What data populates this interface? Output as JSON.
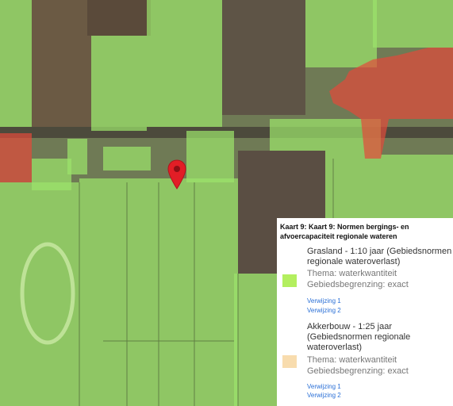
{
  "map": {
    "overlay_colors": {
      "grasland": "#9be36b",
      "bebouwing": "#e34a3b",
      "akkerbouw": "#f4d7a8"
    },
    "marker_icon": "map-pin-icon",
    "marker_color": "#e21e26"
  },
  "legend": {
    "title": "Kaart 9: Kaart 9: Normen bergings- en afvoercapaciteit regionale wateren",
    "entries": [
      {
        "name": "Grasland - 1:10 jaar (Gebiedsnormen regionale wateroverlast)",
        "theme": "Thema: waterkwantiteit",
        "boundary": "Gebiedsbegrenzing: exact",
        "swatch_color": "#b3ef5f",
        "links": [
          "Verwijzing 1",
          "Verwijzing 2"
        ]
      },
      {
        "name": "Akkerbouw - 1:25 jaar (Gebiedsnormen regionale wateroverlast)",
        "theme": "Thema: waterkwantiteit",
        "boundary": "Gebiedsbegrenzing: exact",
        "swatch_color": "#f8dcae",
        "links": [
          "Verwijzing 1",
          "Verwijzing 2"
        ]
      }
    ]
  }
}
